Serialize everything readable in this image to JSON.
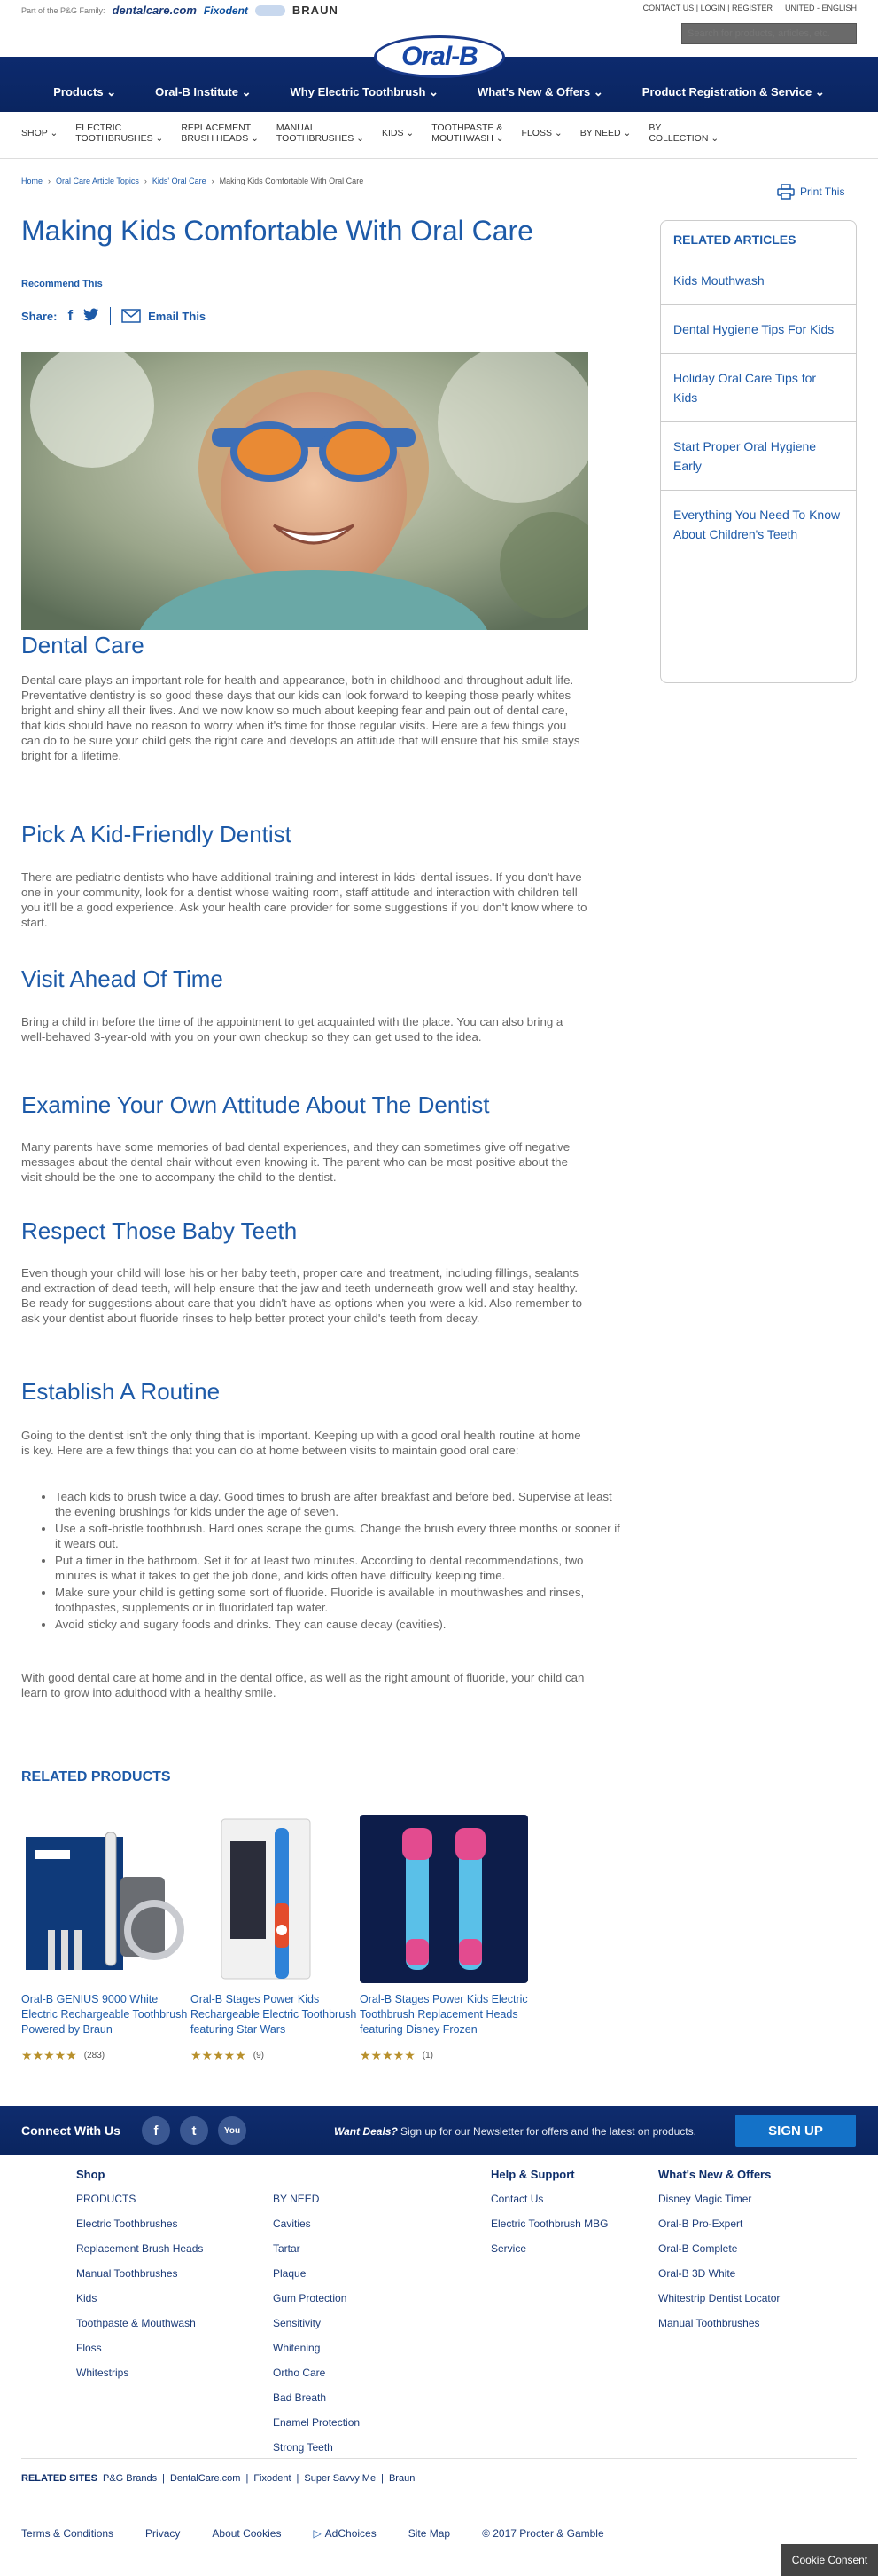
{
  "utility": {
    "part_of": "Part of the P&G Family:",
    "brands": [
      "dentalcare.com",
      "Fixodent",
      "",
      "BRAUN"
    ],
    "contact": "CONTACT US",
    "login": "LOGIN",
    "register": "REGISTER",
    "region": "UNITED - ENGLISH",
    "search_placeholder": "Search for products, articles, etc."
  },
  "brand": {
    "logo": "Oral-B"
  },
  "main_nav": [
    "Products",
    "Oral-B Institute",
    "Why Electric Toothbrush",
    "What's New & Offers",
    "Product Registration & Service"
  ],
  "cat_nav": [
    {
      "l1": "SHOP",
      "l2": ""
    },
    {
      "l1": "ELECTRIC",
      "l2": "TOOTHBRUSHES"
    },
    {
      "l1": "REPLACEMENT",
      "l2": "BRUSH HEADS"
    },
    {
      "l1": "MANUAL",
      "l2": "TOOTHBRUSHES"
    },
    {
      "l1": "KIDS",
      "l2": ""
    },
    {
      "l1": "TOOTHPASTE &",
      "l2": "MOUTHWASH"
    },
    {
      "l1": "FLOSS",
      "l2": ""
    },
    {
      "l1": "BY NEED",
      "l2": ""
    },
    {
      "l1": "BY",
      "l2": "COLLECTION"
    }
  ],
  "breadcrumb": [
    "Home",
    "Oral Care Article Topics",
    "Kids' Oral Care",
    "Making Kids Comfortable With Oral Care"
  ],
  "print_label": "Print This",
  "article": {
    "title": "Making Kids Comfortable With Oral Care",
    "recommend": "Recommend This",
    "share": "Share:",
    "email": "Email This",
    "sections": [
      {
        "h": "Dental Care",
        "p": "Dental care plays an important role for health and appearance, both in childhood and throughout adult life. Preventative dentistry is so good these days that our kids can look forward to keeping those pearly whites bright and shiny all their lives. And we now know so much about keeping fear and pain out of dental care, that kids should have no reason to worry when it's time for those regular visits. Here are a few things you can do to be sure your child gets the right care and develops an attitude that will ensure that his smile stays bright for a lifetime."
      },
      {
        "h": "Pick A Kid-Friendly Dentist",
        "p": "There are pediatric dentists who have additional training and interest in kids' dental issues. If you don't have one in your community, look for a dentist whose waiting room, staff attitude and interaction with children tell you it'll be a good experience. Ask your health care provider for some suggestions if you don't know where to start."
      },
      {
        "h": "Visit Ahead Of Time",
        "p": "Bring a child in before the time of the appointment to get acquainted with the place. You can also bring a well-behaved 3-year-old with you on your own checkup so they can get used to the idea."
      },
      {
        "h": "Examine Your Own Attitude About The Dentist",
        "p": "Many parents have some memories of bad dental experiences, and they can sometimes give off negative messages about the dental chair without even knowing it. The parent who can be most positive about the visit should be the one to accompany the child to the dentist."
      },
      {
        "h": "Respect Those Baby Teeth",
        "p": "Even though your child will lose his or her baby teeth, proper care and treatment, including fillings, sealants and extraction of dead teeth, will help ensure that the jaw and teeth underneath grow well and stay healthy. Be ready for suggestions about care that you didn't have as options when you were a kid. Also remember to ask your dentist about fluoride rinses to help better protect your child's teeth from decay."
      },
      {
        "h": "Establish A Routine",
        "p": "Going to the dentist isn't the only thing that is important. Keeping up with a good oral health routine at home is key. Here are a few things that you can do at home between visits to maintain good oral care:"
      }
    ],
    "routine": [
      "Teach kids to brush twice a day. Good times to brush are after breakfast and before bed. Supervise at least the evening brushings for kids under the age of seven.",
      "Use a soft-bristle toothbrush. Hard ones scrape the gums. Change the brush every three months or sooner if it wears out.",
      "Put a timer in the bathroom. Set it for at least two minutes. According to dental recommendations, two minutes is what it takes to get the job done, and kids often have difficulty keeping time.",
      "Make sure your child is getting some sort of fluoride. Fluoride is available in mouthwashes and rinses, toothpastes, supplements or in fluoridated tap water.",
      "Avoid sticky and sugary foods and drinks. They can cause decay (cavities)."
    ],
    "closing": "With good dental care at home and in the dental office, as well as the right amount of fluoride, your child can learn to grow into adulthood with a healthy smile."
  },
  "related_articles": {
    "heading": "RELATED ARTICLES",
    "items": [
      "Kids Mouthwash",
      "Dental Hygiene Tips For Kids",
      "Holiday Oral Care Tips for Kids",
      "Start Proper Oral Hygiene Early",
      "Everything You Need To Know About Children's Teeth"
    ]
  },
  "related_products": {
    "heading": "RELATED PRODUCTS",
    "items": [
      {
        "name": "Oral-B GENIUS 9000 White Electric Rechargeable Toothbrush Powered by Braun",
        "rating": 5,
        "count": "(283)"
      },
      {
        "name": "Oral-B Stages Power Kids Rechargeable Electric Toothbrush featuring Star Wars",
        "rating": 5,
        "count": "(9)"
      },
      {
        "name": "Oral-B Stages Power Kids Electric Toothbrush Replacement Heads featuring Disney Frozen",
        "rating": 5,
        "count": "(1)"
      }
    ],
    "stars": "★★★★★"
  },
  "connect": {
    "label": "Connect With Us",
    "social": [
      "f",
      "t",
      "You"
    ],
    "deals": "Want Deals?",
    "newsletter": "Sign up for our Newsletter for offers and the latest on products.",
    "signup": "SIGN UP"
  },
  "footer": {
    "shop_heading": "Shop",
    "col1": [
      "PRODUCTS",
      "Electric Toothbrushes",
      "Replacement Brush Heads",
      "Manual Toothbrushes",
      "Kids",
      "Toothpaste & Mouthwash",
      "Floss",
      "Whitestrips"
    ],
    "col2": [
      "BY NEED",
      "Cavities",
      "Tartar",
      "Plaque",
      "Gum Protection",
      "Sensitivity",
      "Whitening",
      "Ortho Care",
      "Bad Breath",
      "Enamel Protection",
      "Strong Teeth"
    ],
    "help_heading": "Help & Support",
    "help": [
      "Contact Us",
      "Electric Toothbrush MBG",
      "Service"
    ],
    "new_heading": "What's New & Offers",
    "new": [
      "Disney Magic Timer",
      "Oral-B Pro-Expert",
      "Oral-B Complete",
      "Oral-B 3D White",
      "Whitestrip Dentist Locator",
      "Manual Toothbrushes"
    ],
    "related_sites_label": "RELATED SITES",
    "related_sites": [
      "P&G Brands",
      "|",
      "DentalCare.com",
      "|",
      "Fixodent",
      "|",
      "Super Savvy Me",
      "|",
      "Braun"
    ],
    "legal": [
      "Terms & Conditions",
      "Privacy",
      "About Cookies",
      "AdChoices",
      "Site Map",
      "© 2017 Procter & Gamble"
    ],
    "cookie": "Cookie Consent"
  },
  "colors": {
    "brand_blue": "#1d5aa8",
    "nav_dark": "#0d2a6e",
    "star": "#b8902c",
    "signup": "#1472c8"
  }
}
